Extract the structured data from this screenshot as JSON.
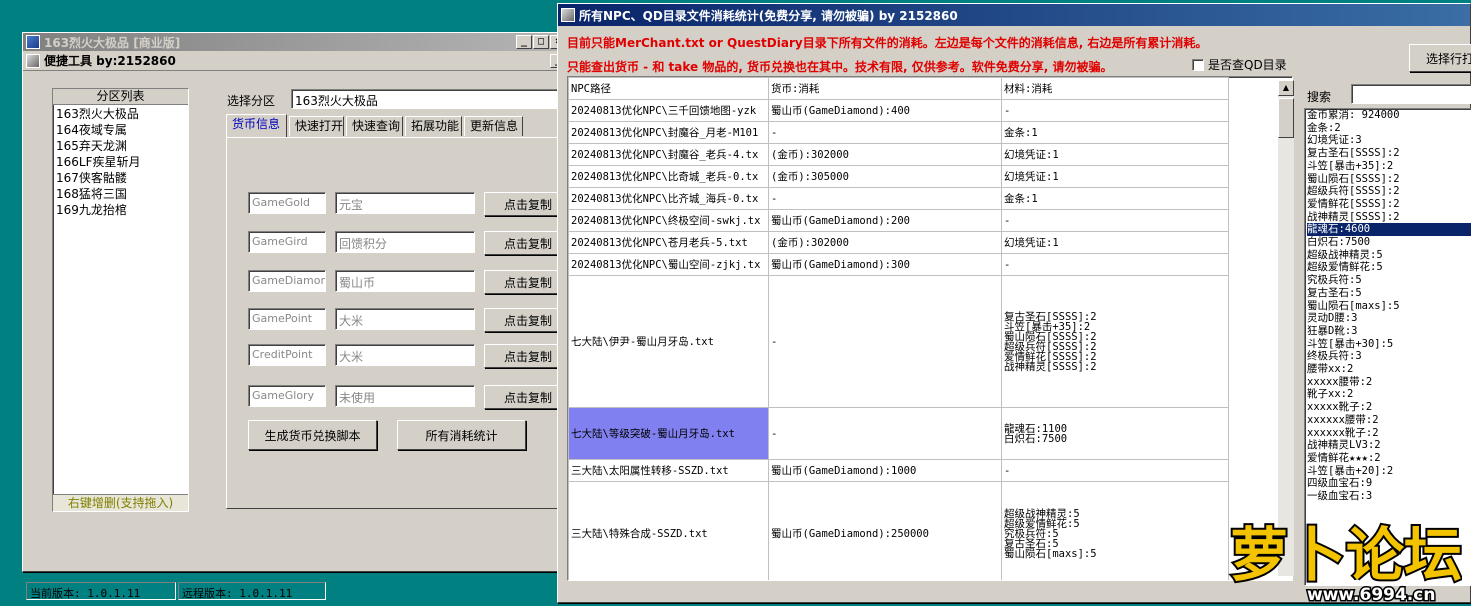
{
  "win1": {
    "title": "163烈火大极品 [商业版]",
    "sub_title": "便捷工具  by:2152860",
    "partition_header": "分区列表",
    "partitions": [
      "163烈火大极品",
      "164夜域专属",
      "165弃天龙渊",
      "166LF疾星斩月",
      "167侠客骷髅",
      "168猛将三国",
      "169九龙抬棺"
    ],
    "partition_footer": "右键增删(支持拖入)",
    "select_label": "选择分区",
    "select_value": "163烈火大极品",
    "tabs": [
      "货币信息",
      "快速打开",
      "快速查询",
      "拓展功能",
      "更新信息"
    ],
    "currency_rows": [
      {
        "code": "GameGold",
        "name": "元宝",
        "button": "点击复制"
      },
      {
        "code": "GameGird",
        "name": "回馈积分",
        "button": "点击复制"
      },
      {
        "code": "GameDiamond",
        "name": "蜀山币",
        "button": "点击复制"
      },
      {
        "code": "GamePoint",
        "name": "大米",
        "button": "点击复制"
      },
      {
        "code": "CreditPoint",
        "name": "大米",
        "button": "点击复制"
      },
      {
        "code": "GameGlory",
        "name": "未使用",
        "button": "点击复制"
      }
    ],
    "gen_button": "生成货币兑换脚本",
    "stats_button": "所有消耗统计",
    "status_local": "当前版本: 1.0.1.11",
    "status_remote": "远程版本: 1.0.1.11"
  },
  "win2": {
    "title": "所有NPC、QD目录文件消耗统计(免费分享, 请勿被骗)    by 2152860",
    "notice1": "目前只能MerChant.txt or QuestDiary目录下所有文件的消耗。左边是每个文件的消耗信息, 右边是所有累计消耗。",
    "notice2": "只能查出货币 - 和 take 物品的, 货币兑换也在其中。技术有限, 仅供参考。软件免费分享, 请勿被骗。",
    "qd_checkbox": "是否查QD目录",
    "select_button": "选择行打",
    "search_label": "搜索",
    "columns": [
      "NPC路径",
      "货币:消耗",
      "材料:消耗"
    ],
    "rows": [
      {
        "path": "20240813优化NPC\\三千回馈地图-yzk",
        "currency": "蜀山币(GameDiamond):400",
        "material": [
          "-"
        ]
      },
      {
        "path": "20240813优化NPC\\封魔谷_月老-M101",
        "currency": "-",
        "material": [
          "金条:1"
        ]
      },
      {
        "path": "20240813优化NPC\\封魔谷_老兵-4.tx",
        "currency": "(金币):302000",
        "material": [
          "幻境凭证:1"
        ]
      },
      {
        "path": "20240813优化NPC\\比奇城_老兵-0.tx",
        "currency": "(金币):305000",
        "material": [
          "幻境凭证:1"
        ]
      },
      {
        "path": "20240813优化NPC\\比齐城_海兵-0.tx",
        "currency": "-",
        "material": [
          "金条:1"
        ]
      },
      {
        "path": "20240813优化NPC\\终极空间-swkj.tx",
        "currency": "蜀山币(GameDiamond):200",
        "material": [
          "-"
        ]
      },
      {
        "path": "20240813优化NPC\\苍月老兵-5.txt",
        "currency": "(金币):302000",
        "material": [
          "幻境凭证:1"
        ]
      },
      {
        "path": "20240813优化NPC\\蜀山空间-zjkj.tx",
        "currency": "蜀山币(GameDiamond):300",
        "material": [
          "-"
        ]
      },
      {
        "path": "七大陆\\伊尹-蜀山月牙岛.txt",
        "currency": "-",
        "material": [
          "复古圣石[SSSS]:2",
          "斗笠[暴击+35]:2",
          "蜀山陨石[SSSS]:2",
          "超级兵符[SSSS]:2",
          "爱情鲜花[SSSS]:2",
          "战神精灵[SSSS]:2"
        ]
      },
      {
        "path": "七大陆\\等级突破-蜀山月牙岛.txt",
        "currency": "-",
        "material": [
          "龍魂石:1100",
          "白炽石:7500"
        ]
      },
      {
        "path": "三大陆\\太阳属性转移-SSZD.txt",
        "currency": "蜀山币(GameDiamond):1000",
        "material": [
          "-"
        ]
      },
      {
        "path": "三大陆\\特殊合成-SSZD.txt",
        "currency": "蜀山币(GameDiamond):250000",
        "material": [
          "超级战神精灵:5",
          "超级爱情鲜花:5",
          "究极兵符:5",
          "复古圣石:5",
          "蜀山陨石[maxs]:5"
        ]
      }
    ],
    "totals": [
      "金币累消: 924000",
      "金条:2",
      "幻境凭证:3",
      "复古圣石[SSSS]:2",
      "斗笠[暴击+35]:2",
      "蜀山陨石[SSSS]:2",
      "超级兵符[SSSS]:2",
      "爱情鲜花[SSSS]:2",
      "战神精灵[SSSS]:2",
      "龍魂石:4600",
      "白炽石:7500",
      "超级战神精灵:5",
      "超级爱情鲜花:5",
      "究极兵符:5",
      "复古圣石:5",
      "蜀山陨石[maxs]:5",
      "灵动D腰:3",
      "狂暴D靴:3",
      "斗笠[暴击+30]:5",
      "终极兵符:3",
      "腰带xx:2",
      "xxxxx腰带:2",
      "靴子xx:2",
      "xxxxx靴子:2",
      "xxxxxx腰带:2",
      "xxxxxx靴子:2",
      "战神精灵LV3:2",
      "爱情鲜花★★★:2",
      "斗笠[暴击+20]:2",
      "四级血宝石:9",
      "一级血宝石:3"
    ],
    "highlight_index": 9
  },
  "logo": {
    "text": "萝卜论坛",
    "url": "www.6994.cn"
  }
}
